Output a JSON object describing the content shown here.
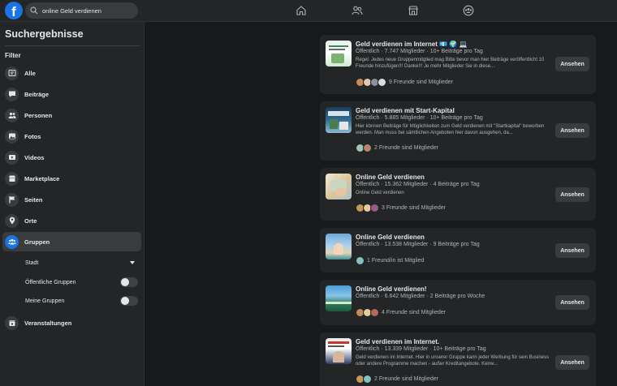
{
  "search": {
    "query": "online Geld verdienen"
  },
  "sidebar": {
    "title": "Suchergebnisse",
    "filter_label": "Filter",
    "items": [
      {
        "label": "Alle",
        "icon": "feed-icon"
      },
      {
        "label": "Beiträge",
        "icon": "posts-icon"
      },
      {
        "label": "Personen",
        "icon": "people-icon"
      },
      {
        "label": "Fotos",
        "icon": "photos-icon"
      },
      {
        "label": "Videos",
        "icon": "video-icon"
      },
      {
        "label": "Marketplace",
        "icon": "marketplace-icon"
      },
      {
        "label": "Seiten",
        "icon": "flag-icon"
      },
      {
        "label": "Orte",
        "icon": "pin-icon"
      },
      {
        "label": "Gruppen",
        "icon": "groups-icon",
        "active": true
      },
      {
        "label": "Veranstaltungen",
        "icon": "calendar-icon"
      }
    ],
    "group_filters": {
      "city": "Stadt",
      "public_groups": "Öffentliche Gruppen",
      "my_groups": "Meine Gruppen"
    }
  },
  "results": [
    {
      "name": "Geld verdienen im Internet 💶 🌍 💻",
      "meta": "Öffentlich · 7.747 Mitglieder · 10+ Beiträge pro Tag",
      "description": "Regel: Jedes neue Gruppenmitglied mag Bitte bevor man hier Beiträge veröffentlicht 10 Freunde hinzufügen!!! Danke!!! Je mehr Mitglieder Sie in diese...",
      "friends": "9 Freunde sind Mitglieder",
      "button": "Ansehen"
    },
    {
      "name": "Geld verdienen mit Start-Kapital",
      "meta": "Öffentlich · 5.885 Mitglieder · 10+ Beiträge pro Tag",
      "description": "Hier können Beiträge für Möglichkeiten zum Geld verdienen mit \"Startkapital\" beworben werden. Man muss bei sämtlichen Angeboten hier davon ausgehen, da...",
      "friends": "2 Freunde sind Mitglieder",
      "button": "Ansehen"
    },
    {
      "name": "Online Geld verdienen",
      "meta": "Öffentlich · 15.362 Mitglieder · 4 Beiträge pro Tag",
      "description": "Online Geld verdienen",
      "friends": "3 Freunde sind Mitglieder",
      "button": "Ansehen"
    },
    {
      "name": "Online Geld verdienen",
      "meta": "Öffentlich · 13.538 Mitglieder · 9 Beiträge pro Tag",
      "description": "",
      "friends": "1 Freund/in ist Mitglied",
      "button": "Ansehen"
    },
    {
      "name": "Online Geld verdienen!",
      "meta": "Öffentlich · 6.642 Mitglieder · 2 Beiträge pro Woche",
      "description": "",
      "friends": "4 Freunde sind Mitglieder",
      "button": "Ansehen"
    },
    {
      "name": "Geld verdienen im Internet.",
      "meta": "Öffentlich · 13.339 Mitglieder · 10+ Beiträge pro Tag",
      "description": "Geld verdienen im Internet. Hier in unserer Gruppe kann jeder Werbung für sein Business oder andere Programme machen - außer Kreditangebote. Keine...",
      "friends": "2 Freunde sind Mitglieder",
      "button": "Ansehen"
    }
  ],
  "colors": {
    "accent": "#1b74e4",
    "background": "#18191a",
    "surface": "#242526",
    "button": "#3a3b3c"
  }
}
